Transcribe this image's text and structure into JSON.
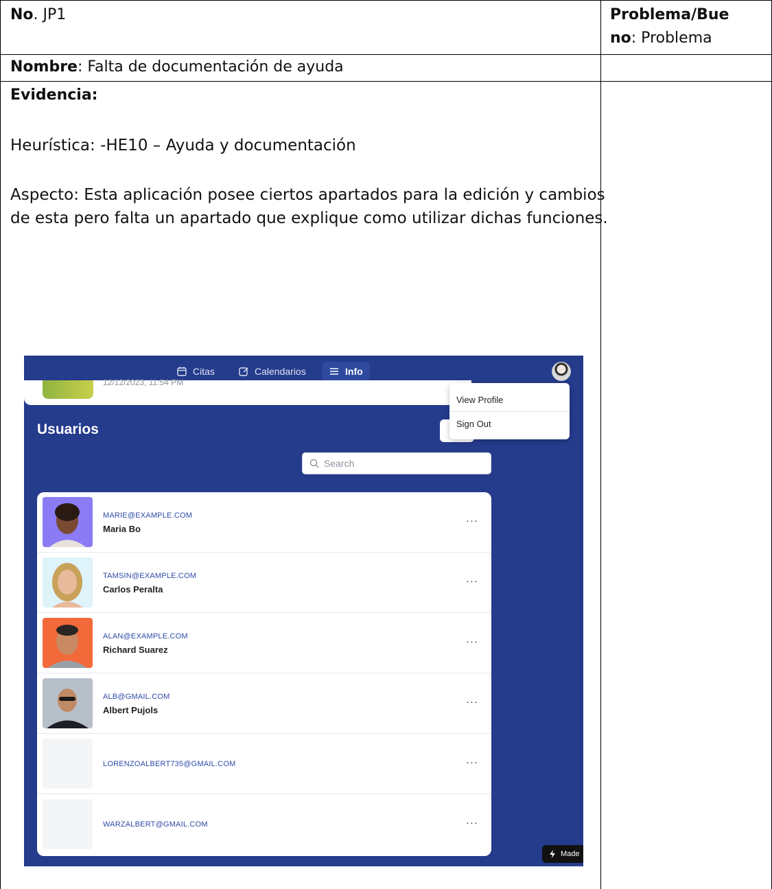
{
  "document": {
    "no_label": "No",
    "no_value": ". JP1",
    "type_label_line1": "Problema/Bue",
    "type_label_line2": "no",
    "type_value": ": Problema",
    "name_label": "Nombre",
    "name_value": ": Falta de documentación de ayuda",
    "evidence_label": "Evidencia:",
    "heuristic": "Heurística: -HE10 – Ayuda y documentación",
    "aspect_line1": "Aspecto: Esta aplicación posee ciertos apartados para la edición y cambios",
    "aspect_line2": "de esta pero falta un apartado que explique como utilizar dichas funciones."
  },
  "app": {
    "nav": {
      "citas": "Citas",
      "calendarios": "Calendarios",
      "info": "Info"
    },
    "prev_card_timestamp": "12/12/2023, 11:54 PM",
    "menu": {
      "view_profile": "View Profile",
      "sign_out": "Sign Out"
    },
    "title": "Usuarios",
    "search_placeholder": "Search",
    "users": [
      {
        "email": "MARIE@EXAMPLE.COM",
        "name": "Maria Bo",
        "photo_bg": "#8b7cf6"
      },
      {
        "email": "TAMSIN@EXAMPLE.COM",
        "name": "Carlos Peralta",
        "photo_bg": "#dff3fb"
      },
      {
        "email": "ALAN@EXAMPLE.COM",
        "name": "Richard Suarez",
        "photo_bg": "#f26a3a"
      },
      {
        "email": "ALB@GMAIL.COM",
        "name": "Albert Pujols",
        "photo_bg": "#c9ced6"
      },
      {
        "email": "LORENZOALBERT735@GMAIL.COM",
        "name": "",
        "photo_bg": "#f4f5f6"
      },
      {
        "email": "WARZALBERT@GMAIL.COM",
        "name": "",
        "photo_bg": "#f4f5f6"
      }
    ],
    "row_menu_glyph": "···",
    "made_badge": "Made"
  },
  "colors": {
    "app_bg": "#253b8c",
    "link_blue": "#2d4aa6"
  }
}
